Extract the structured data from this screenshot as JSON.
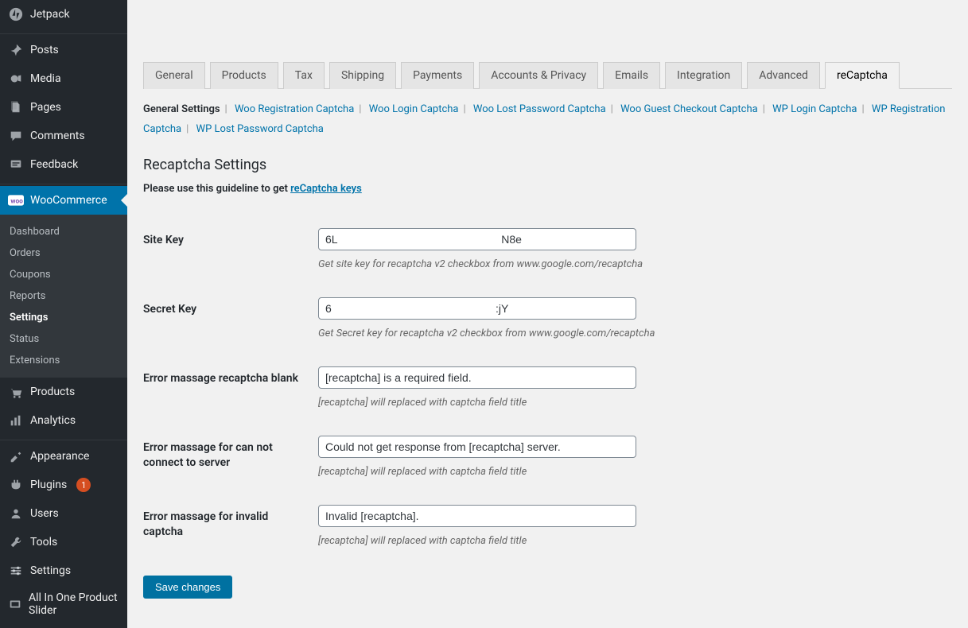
{
  "sidebar": {
    "items": [
      {
        "label": "Jetpack",
        "icon": "jetpack"
      },
      {
        "label": "Posts",
        "icon": "pin"
      },
      {
        "label": "Media",
        "icon": "media"
      },
      {
        "label": "Pages",
        "icon": "pages"
      },
      {
        "label": "Comments",
        "icon": "comments"
      },
      {
        "label": "Feedback",
        "icon": "feedback"
      },
      {
        "label": "WooCommerce",
        "icon": "woo",
        "active": true
      },
      {
        "label": "Products",
        "icon": "products"
      },
      {
        "label": "Analytics",
        "icon": "analytics"
      },
      {
        "label": "Appearance",
        "icon": "appearance"
      },
      {
        "label": "Plugins",
        "icon": "plugins",
        "badge": "1"
      },
      {
        "label": "Users",
        "icon": "users"
      },
      {
        "label": "Tools",
        "icon": "tools"
      },
      {
        "label": "Settings",
        "icon": "settings"
      },
      {
        "label": "All In One Product Slider",
        "icon": "slider"
      }
    ],
    "submenu": [
      {
        "label": "Dashboard"
      },
      {
        "label": "Orders"
      },
      {
        "label": "Coupons"
      },
      {
        "label": "Reports"
      },
      {
        "label": "Settings",
        "current": true
      },
      {
        "label": "Status"
      },
      {
        "label": "Extensions"
      }
    ]
  },
  "tabs": [
    "General",
    "Products",
    "Tax",
    "Shipping",
    "Payments",
    "Accounts & Privacy",
    "Emails",
    "Integration",
    "Advanced",
    "reCaptcha"
  ],
  "active_tab": "reCaptcha",
  "subtabs": [
    {
      "label": "General Settings",
      "current": true
    },
    {
      "label": "Woo Registration Captcha"
    },
    {
      "label": "Woo Login Captcha"
    },
    {
      "label": "Woo Lost Password Captcha"
    },
    {
      "label": "Woo Guest Checkout Captcha"
    },
    {
      "label": "WP Login Captcha"
    },
    {
      "label": "WP Registration Captcha"
    },
    {
      "label": "WP Lost Password Captcha"
    }
  ],
  "section_title": "Recaptcha Settings",
  "guideline_prefix": "Please use this guideline to get ",
  "guideline_link": "reCaptcha keys",
  "fields": {
    "site_key": {
      "label": "Site Key",
      "value": "6L                                                     N8e",
      "desc": "Get site key for recaptcha v2 checkbox from www.google.com/recaptcha"
    },
    "secret_key": {
      "label": "Secret Key",
      "value": "6                                                     :jY",
      "desc": "Get Secret key for recaptcha v2 checkbox from www.google.com/recaptcha"
    },
    "err_blank": {
      "label": "Error massage recaptcha blank",
      "value": "[recaptcha] is a required field.",
      "desc": "[recaptcha] will replaced with captcha field title"
    },
    "err_server": {
      "label": "Error massage for can not connect to server",
      "value": "Could not get response from [recaptcha] server.",
      "desc": "[recaptcha] will replaced with captcha field title"
    },
    "err_invalid": {
      "label": "Error massage for invalid captcha",
      "value": "Invalid [recaptcha].",
      "desc": "[recaptcha] will replaced with captcha field title"
    }
  },
  "save_button": "Save changes"
}
